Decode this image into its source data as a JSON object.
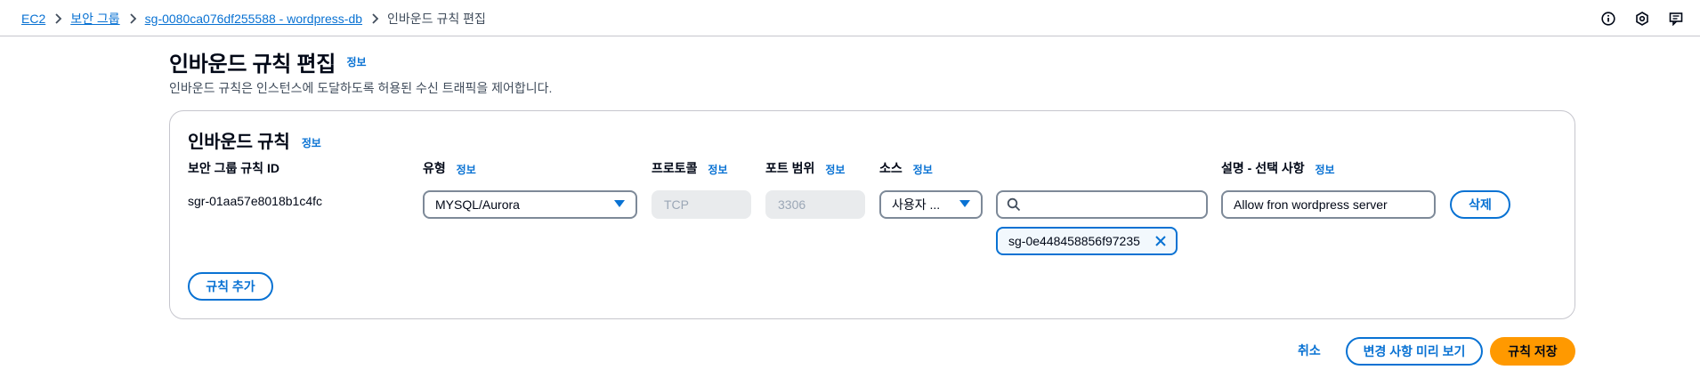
{
  "breadcrumb": {
    "items": [
      "EC2",
      "보안 그룹",
      "sg-0080ca076df255588 - wordpress-db"
    ],
    "current": "인바운드 규칙 편집"
  },
  "top_icons": [
    "info-icon",
    "settings-icon",
    "feedback-icon"
  ],
  "header": {
    "title": "인바운드 규칙 편집",
    "info": "정보",
    "description": "인바운드 규칙은 인스턴스에 도달하도록 허용된 수신 트래픽을 제어합니다."
  },
  "rules_section": {
    "title": "인바운드 규칙",
    "info": "정보",
    "columns": {
      "rule_id": "보안 그룹 규칙 ID",
      "type": "유형",
      "protocol": "프로토콜",
      "port_range": "포트 범위",
      "source": "소스",
      "description": "설명 - 선택 사항"
    },
    "column_info": "정보",
    "rows": [
      {
        "rule_id": "sgr-01aa57e8018b1c4fc",
        "type": "MYSQL/Aurora",
        "protocol": "TCP",
        "port_range": "3306",
        "source_type": "사용자 ...",
        "source_search_value": "",
        "source_token": "sg-0e448458856f97235",
        "description": "Allow fron wordpress server",
        "delete_label": "삭제"
      }
    ],
    "add_rule_label": "규칙 추가"
  },
  "footer": {
    "cancel_label": "취소",
    "preview_label": "변경 사항 미리 보기",
    "save_label": "규칙 저장"
  },
  "colors": {
    "link": "#0972d3",
    "primary_button": "#ff9900",
    "border": "#c6c6cd"
  }
}
